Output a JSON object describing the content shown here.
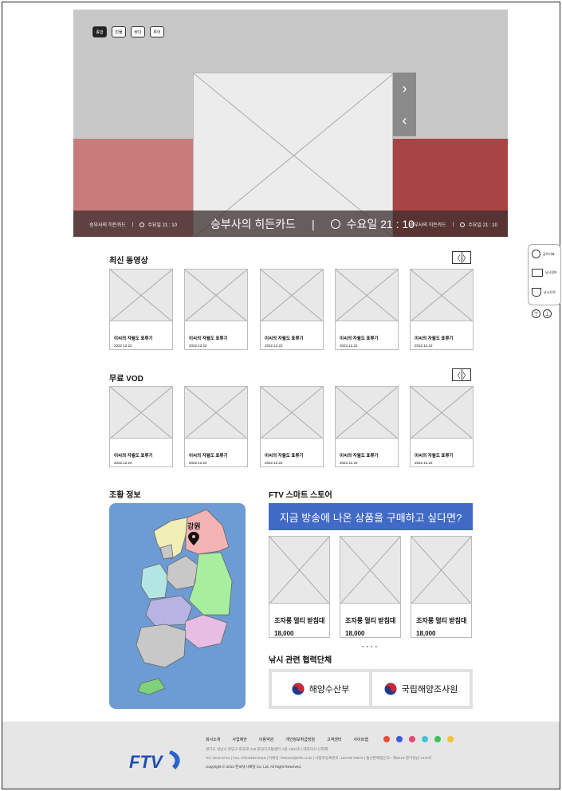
{
  "hero": {
    "tabs": [
      "종합",
      "민물",
      "바다",
      "루어"
    ],
    "prev_label": "‹",
    "next_label": "›",
    "left_title": "승부사의 히든카드",
    "left_time": "수요일 21 : 10",
    "center_title": "승부사의 히든카드",
    "center_time": "수요일 21 : 10",
    "right_title": "승부사의 히든카드",
    "right_time": "수요일 21 : 10",
    "separator": "|"
  },
  "latest": {
    "title": "최신 동영상",
    "items": [
      {
        "title": "이씨의 자월도 표류기",
        "date": "2022.12.22"
      },
      {
        "title": "이씨의 자월도 표류기",
        "date": "2022.12.22"
      },
      {
        "title": "이씨의 자월도 표류기",
        "date": "2022.12.22"
      },
      {
        "title": "이씨의 자월도 표류기",
        "date": "2022.12.22"
      },
      {
        "title": "이씨의 자월도 표류기",
        "date": "2022.12.22"
      }
    ]
  },
  "vod": {
    "title": "무료 VOD",
    "items": [
      {
        "title": "이씨의 자월도 표류기",
        "date": "2022.12.22"
      },
      {
        "title": "이씨의 자월도 표류기",
        "date": "2022.12.22"
      },
      {
        "title": "이씨의 자월도 표류기",
        "date": "2022.12.22"
      },
      {
        "title": "이씨의 자월도 표류기",
        "date": "2022.12.22"
      },
      {
        "title": "이씨의 자월도 표류기",
        "date": "2022.12.22"
      }
    ]
  },
  "pager": {
    "prev": "〈",
    "next": "〉"
  },
  "catch_info": {
    "title": "조황 정보",
    "selected_region": "강원"
  },
  "store": {
    "title": "FTV 스마트 스토어",
    "banner": "지금 방송에 나온 상품을 구매하고 싶다면?",
    "products": [
      {
        "name": "조자룡 멀티 받침대",
        "price": "18,000"
      },
      {
        "name": "조자룡 멀티 받침대",
        "price": "18,000"
      },
      {
        "name": "조자룡 멀티 받침대",
        "price": "18,000"
      }
    ],
    "dots": "● ● ● ●"
  },
  "partners": {
    "title": "낚시 관련 협력단체",
    "items": [
      "해양수산부",
      "국립해양조사원"
    ]
  },
  "float_menu": {
    "items": [
      "금어기표",
      "낚시정보",
      "낚시자격"
    ],
    "top_icon": "⊤",
    "bottom_icon": "⊥"
  },
  "footer": {
    "logo": "FTV",
    "nav": [
      "회사소개",
      "사업제안",
      "이용약관",
      "개인정보취급방침",
      "고객센터",
      "사이트맵"
    ],
    "address": "경기도 성남시 분당구 판교로 242 판교디지털센터 A동 1001호 | 대표이사 나희재",
    "contact": "Tel. 1544-5744 | Fax. 070-8282-8116 | 이메일. ftvkorea@eftv.co.kr | 사업자등록번호 :119-86-79576 | 통신판매업신고 : 제2013-경기성남-1670호",
    "copyright": "Copyright © 2013 한국낚시채널 Co, Ltd, All Right Reserved.",
    "sns_colors": [
      "#e84c3d",
      "#3b5bdb",
      "#e04970",
      "#45c4d6",
      "#3cc05a",
      "#f2c230"
    ]
  }
}
